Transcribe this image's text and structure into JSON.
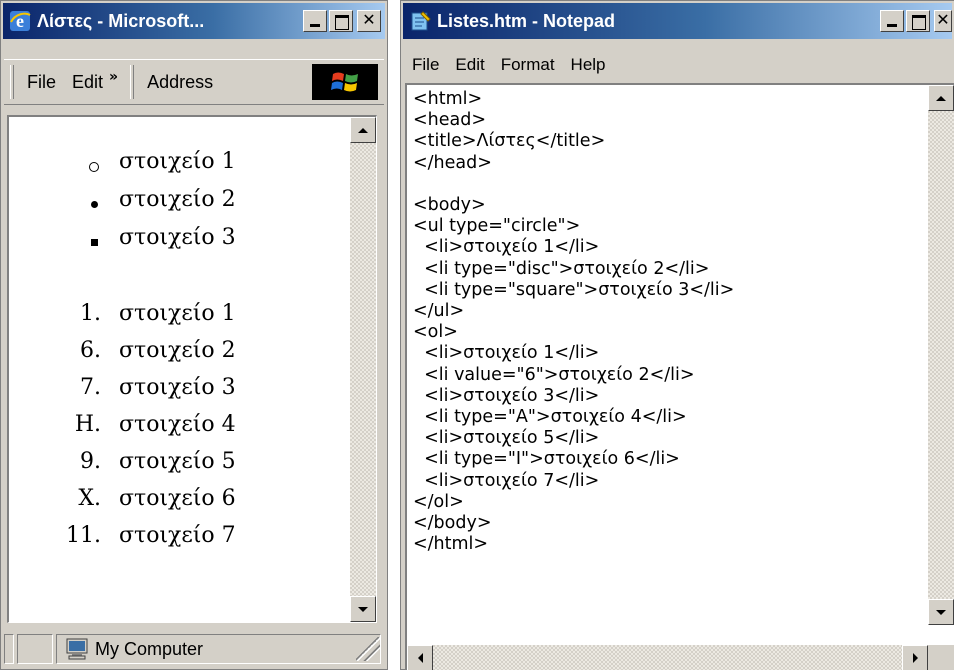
{
  "ie_window": {
    "title": "Λίστες - Microsoft...",
    "toolbar": {
      "file": "File",
      "edit": "Edit",
      "chevron": "»",
      "address": "Address"
    },
    "page": {
      "unordered_list": [
        {
          "marker": "circle",
          "text": "στοιχείο 1"
        },
        {
          "marker": "disc",
          "text": "στοιχείο 2"
        },
        {
          "marker": "square",
          "text": "στοιχείο 3"
        }
      ],
      "ordered_list": [
        {
          "marker": "1.",
          "text": "στοιχείο 1"
        },
        {
          "marker": "6.",
          "text": "στοιχείο 2"
        },
        {
          "marker": "7.",
          "text": "στοιχείο 3"
        },
        {
          "marker": "H.",
          "text": "στοιχείο 4"
        },
        {
          "marker": "9.",
          "text": "στοιχείο 5"
        },
        {
          "marker": "X.",
          "text": "στοιχείο 6"
        },
        {
          "marker": "11.",
          "text": "στοιχείο 7"
        }
      ]
    },
    "status": {
      "zone": "My Computer"
    }
  },
  "notepad_window": {
    "title": "Listes.htm - Notepad",
    "menu": {
      "file": "File",
      "edit": "Edit",
      "format": "Format",
      "help": "Help"
    },
    "code_lines": [
      "<html>",
      "<head>",
      "<title>Λίστες</title>",
      "</head>",
      "",
      "<body>",
      "<ul type=\"circle\">",
      "  <li>στοιχείο 1</li>",
      "  <li type=\"disc\">στοιχείο 2</li>",
      "  <li type=\"square\">στοιχείο 3</li>",
      "</ul>",
      "<ol>",
      "  <li>στοιχείο 1</li>",
      "  <li value=\"6\">στοιχείο 2</li>",
      "  <li>στοιχείο 3</li>",
      "  <li type=\"A\">στοιχείο 4</li>",
      "  <li>στοιχείο 5</li>",
      "  <li type=\"I\">στοιχείο 6</li>",
      "  <li>στοιχείο 7</li>",
      "</ol>",
      "</body>",
      "</html>"
    ]
  },
  "colors": {
    "titlebar_start": "#0a246a",
    "titlebar_end": "#a6caf0",
    "chrome": "#d4d0c8"
  }
}
